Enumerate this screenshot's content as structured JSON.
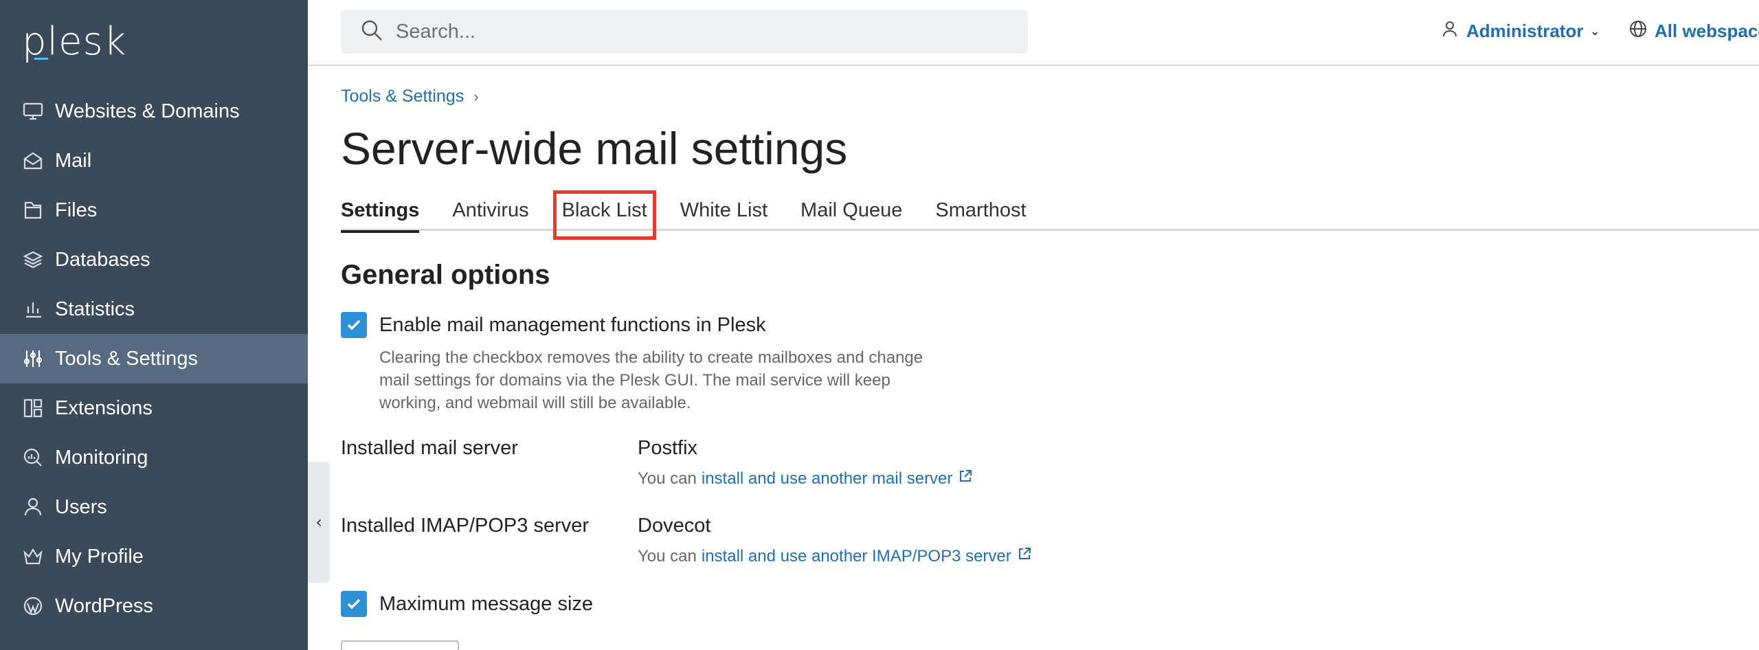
{
  "brand": {
    "logo_text": "plesk"
  },
  "sidebar": {
    "items": [
      {
        "label": "Websites & Domains",
        "icon": "monitor-icon",
        "active": false
      },
      {
        "label": "Mail",
        "icon": "mail-icon",
        "active": false
      },
      {
        "label": "Files",
        "icon": "folder-icon",
        "active": false
      },
      {
        "label": "Databases",
        "icon": "database-icon",
        "active": false
      },
      {
        "label": "Statistics",
        "icon": "bar-chart-icon",
        "active": false
      },
      {
        "label": "Tools & Settings",
        "icon": "sliders-icon",
        "active": true
      },
      {
        "label": "Extensions",
        "icon": "grid-icon",
        "active": false
      },
      {
        "label": "Monitoring",
        "icon": "monitoring-icon",
        "active": false
      },
      {
        "label": "Users",
        "icon": "user-icon",
        "active": false
      },
      {
        "label": "My Profile",
        "icon": "crown-icon",
        "active": false
      },
      {
        "label": "WordPress",
        "icon": "wordpress-icon",
        "active": false
      }
    ]
  },
  "topbar": {
    "search_placeholder": "Search...",
    "user_label": "Administrator",
    "webspace_label": "All webspace"
  },
  "breadcrumb": {
    "item": "Tools & Settings"
  },
  "page": {
    "title": "Server-wide mail settings"
  },
  "tabs": [
    {
      "label": "Settings",
      "active": true
    },
    {
      "label": "Antivirus",
      "active": false
    },
    {
      "label": "Black List",
      "active": false,
      "highlighted": true
    },
    {
      "label": "White List",
      "active": false
    },
    {
      "label": "Mail Queue",
      "active": false
    },
    {
      "label": "Smarthost",
      "active": false
    }
  ],
  "general": {
    "title": "General options",
    "enable_mail_label": "Enable mail management functions in Plesk",
    "enable_mail_checked": true,
    "enable_mail_desc": "Clearing the checkbox removes the ability to create mailboxes and change mail settings for domains via the Plesk GUI. The mail service will keep working, and webmail will still be available.",
    "mail_server_label": "Installed mail server",
    "mail_server_value": "Postfix",
    "mail_server_hint_prefix": "You can",
    "mail_server_hint_link": "install and use another mail server",
    "imap_label": "Installed IMAP/POP3 server",
    "imap_value": "Dovecot",
    "imap_hint_prefix": "You can",
    "imap_hint_link": "install and use another IMAP/POP3 server",
    "max_size_label": "Maximum message size",
    "max_size_checked": true
  },
  "colors": {
    "sidebar_bg": "#3b4a5a",
    "sidebar_active": "#566b82",
    "link": "#1f6eb3",
    "checkbox": "#2d8fd5",
    "highlight": "#e33b2e"
  }
}
